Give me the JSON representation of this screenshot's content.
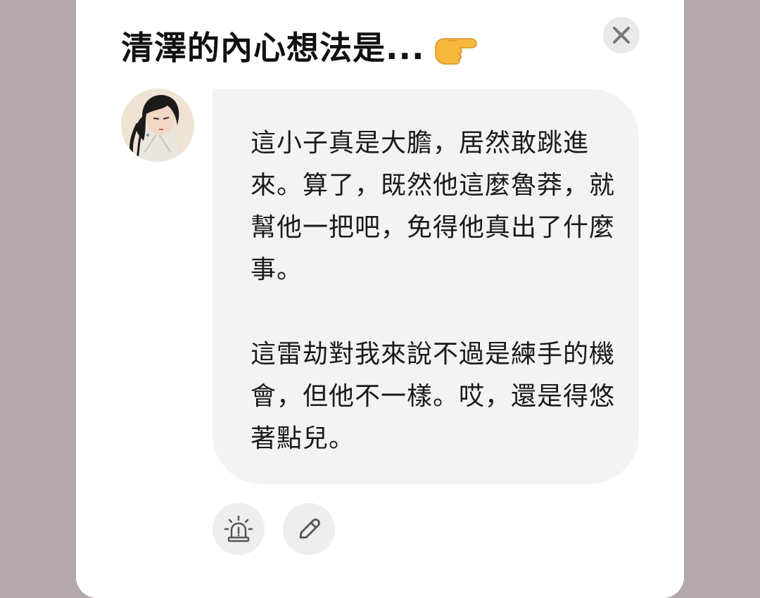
{
  "dialog": {
    "title": "清澤的內心想法是...",
    "title_emoji": "pointing-right-hand-icon",
    "close_icon": "close-icon"
  },
  "message": {
    "avatar": "character-avatar",
    "text": "這小子真是大膽，居然敢跳進來。算了，既然他這麼魯莽，就幫他一把吧，免得他真出了什麼事。\n\n這雷劫對我來說不過是練手的機會，但他不一樣。哎，還是得悠著點兒。"
  },
  "actions": {
    "report_icon": "alarm-siren-icon",
    "edit_icon": "pencil-icon"
  },
  "colors": {
    "backdrop": "#b4aaad",
    "modal": "#ffffff",
    "bubble": "#f3f3f3",
    "button": "#eeeeee",
    "emoji": "#f6b73c"
  }
}
